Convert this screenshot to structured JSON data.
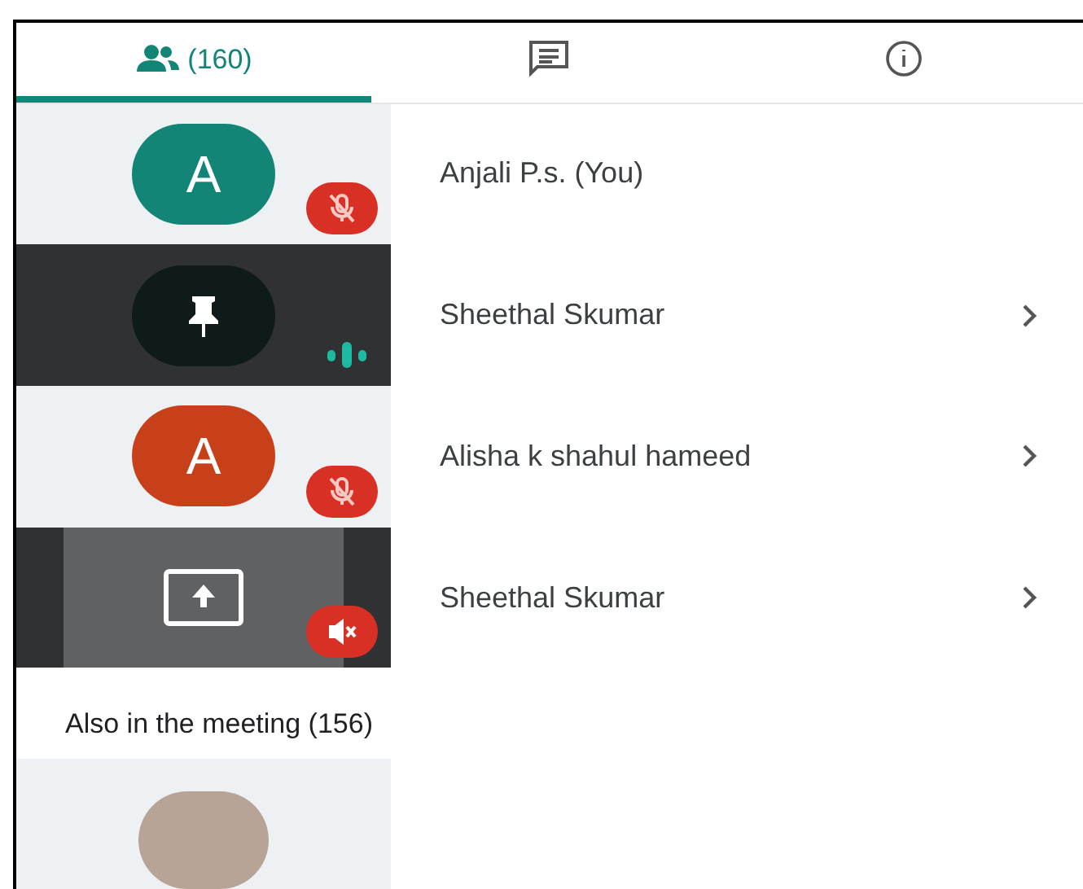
{
  "tabs": [
    {
      "kind": "people",
      "label": "(160)",
      "selected": true
    },
    {
      "kind": "chat",
      "selected": false
    },
    {
      "kind": "info",
      "selected": false
    }
  ],
  "participants": [
    {
      "name": "Anjali P.s. (You)",
      "kind": "avatar",
      "letter": "A",
      "color": "#128576",
      "badge": {
        "kind": "mic-off"
      },
      "chevron": false
    },
    {
      "name": "Sheethal Skumar",
      "kind": "pin",
      "badge": {
        "kind": "speaking"
      },
      "chevron": true
    },
    {
      "name": "Alisha k shahul hameed",
      "kind": "avatar",
      "letter": "A",
      "color": "#c8401a",
      "badge": {
        "kind": "mic-off"
      },
      "chevron": true
    },
    {
      "name": "Sheethal Skumar",
      "kind": "screen",
      "badge": {
        "kind": "audio-off"
      },
      "chevron": true
    }
  ],
  "also_in_meeting": {
    "heading": "Also in the meeting (156)"
  }
}
